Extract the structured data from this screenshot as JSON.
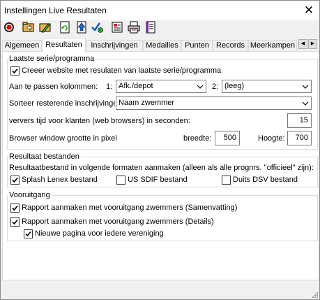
{
  "window": {
    "title": "Instellingen Live Resultaten"
  },
  "toolbar": {
    "buttons": [
      {
        "icon": "record-icon"
      },
      {
        "icon": "open-folder-icon"
      },
      {
        "icon": "edit-folder-icon"
      },
      {
        "icon": "refresh-icon"
      },
      {
        "icon": "upload-icon"
      },
      {
        "icon": "check-icon"
      },
      {
        "icon": "settings-icon"
      },
      {
        "icon": "print-icon"
      },
      {
        "icon": "page-icon"
      }
    ]
  },
  "tabs": [
    {
      "label": "Algemeen"
    },
    {
      "label": "Resultaten",
      "active": true
    },
    {
      "label": "Inschrijvingen"
    },
    {
      "label": "Medailles"
    },
    {
      "label": "Punten"
    },
    {
      "label": "Records"
    },
    {
      "label": "Meerkampen"
    }
  ],
  "group_latest": {
    "title": "Laatste serie/programma",
    "create_website": {
      "label": "Creeer website met resulaten van laatste serie/programma",
      "checked": true
    },
    "columns_label": "Aan te passen kolommen:",
    "col1": {
      "prefix": "1:",
      "value": "Afk./depot"
    },
    "col2": {
      "prefix": "2:",
      "value": "(leeg)"
    },
    "sort_label": "Sorteer resterende inschrijvinge",
    "sort_value": "Naam zwemmer",
    "refresh_label": "ververs tijd voor klanten (web browsers) in seconden:",
    "refresh_value": "15",
    "browser_label": "Browser window grootte in pixel",
    "width_label": "breedte:",
    "width_value": "500",
    "height_label": "Hoogte:",
    "height_value": "700"
  },
  "group_results": {
    "title": "Resultaat bestanden",
    "description": "Resultaatbestand in volgende formaten aanmaken (alleen als alle prognrs. \"officieel\" zijn):",
    "lenex": {
      "label": "Splash Lenex bestand",
      "checked": true
    },
    "sdif": {
      "label": "US SDIF bestand",
      "checked": false
    },
    "dsv": {
      "label": "Duits DSV bestand",
      "checked": false
    }
  },
  "group_progress": {
    "title": "Vooruitgang",
    "summary": {
      "label": "Rapport aanmaken met vooruitgang zwemmers (Samenvatting)",
      "checked": true
    },
    "details": {
      "label": "Rapport aanmaken met vooruitgang zwemmers (Details)",
      "checked": true
    },
    "new_page": {
      "label": "Nieuwe pagina voor iedere vereniging",
      "checked": true
    }
  },
  "colors": {
    "accent": "#0b5cc5",
    "border": "#dcdcdc",
    "background": "#f0f0f0"
  }
}
